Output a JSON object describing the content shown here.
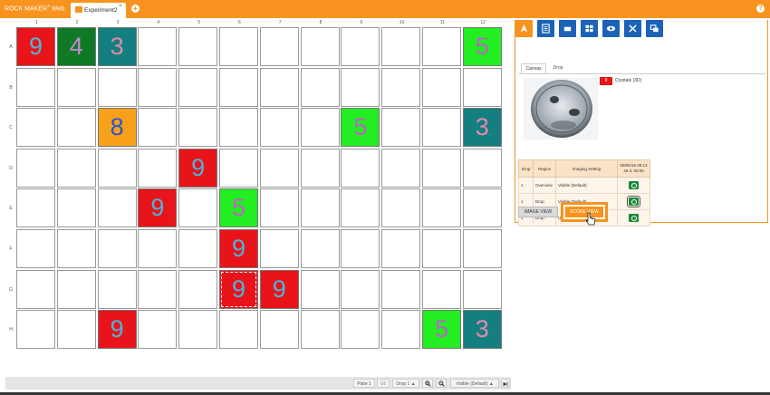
{
  "app": {
    "title": "ROCK MAKER",
    "title_sup": "®",
    "title_suffix": "Web",
    "tab_label": "Experiment2",
    "tab_close": "×",
    "new_tab": "+",
    "help": "?"
  },
  "plate": {
    "columns": [
      "1",
      "2",
      "3",
      "4",
      "5",
      "6",
      "7",
      "8",
      "9",
      "10",
      "11",
      "12"
    ],
    "rows": [
      "A",
      "B",
      "C",
      "D",
      "E",
      "F",
      "G",
      "H"
    ],
    "scored_wells": [
      {
        "row": "A",
        "col": 1,
        "score": "9",
        "bg": "#e8141a",
        "fg": "#4fb3d9"
      },
      {
        "row": "A",
        "col": 2,
        "score": "4",
        "bg": "#0f7a25",
        "fg": "#c08ccf"
      },
      {
        "row": "A",
        "col": 3,
        "score": "3",
        "bg": "#137f80",
        "fg": "#e48aa8"
      },
      {
        "row": "A",
        "col": 12,
        "score": "5",
        "bg": "#22ee22",
        "fg": "#c060c8"
      },
      {
        "row": "C",
        "col": 3,
        "score": "8",
        "bg": "#f9a01b",
        "fg": "#2a57c8"
      },
      {
        "row": "C",
        "col": 9,
        "score": "5",
        "bg": "#22ee22",
        "fg": "#c060c8"
      },
      {
        "row": "C",
        "col": 12,
        "score": "3",
        "bg": "#137f80",
        "fg": "#e48aa8"
      },
      {
        "row": "D",
        "col": 5,
        "score": "9",
        "bg": "#e8141a",
        "fg": "#4fb3d9"
      },
      {
        "row": "E",
        "col": 4,
        "score": "9",
        "bg": "#e8141a",
        "fg": "#4fb3d9"
      },
      {
        "row": "E",
        "col": 6,
        "score": "5",
        "bg": "#22ee22",
        "fg": "#c060c8"
      },
      {
        "row": "F",
        "col": 6,
        "score": "9",
        "bg": "#e8141a",
        "fg": "#4fb3d9"
      },
      {
        "row": "G",
        "col": 6,
        "score": "9",
        "bg": "#e8141a",
        "fg": "#4fb3d9",
        "selected": true
      },
      {
        "row": "G",
        "col": 7,
        "score": "9",
        "bg": "#e8141a",
        "fg": "#4fb3d9"
      },
      {
        "row": "H",
        "col": 3,
        "score": "9",
        "bg": "#e8141a",
        "fg": "#4fb3d9"
      },
      {
        "row": "H",
        "col": 11,
        "score": "5",
        "bg": "#22ee22",
        "fg": "#c060c8"
      },
      {
        "row": "H",
        "col": 12,
        "score": "3",
        "bg": "#137f80",
        "fg": "#e48aa8"
      }
    ]
  },
  "bottom_bar": {
    "plate": "Plate 1",
    "well": "G6",
    "drop": "Drop 1",
    "drop_arrow": "▲",
    "imaging": "Visible (Default)",
    "imaging_arrow": "▲"
  },
  "right_panel": {
    "toolbar_icons": [
      "pointer-icon",
      "list-icon",
      "rectangle-icon",
      "grid-icon",
      "eye-icon",
      "crossed-tools-icon",
      "copy-windows-icon"
    ],
    "tabs": {
      "canvas": "Canvas",
      "drop": "Drop"
    },
    "score": {
      "value": "9",
      "label": "Crystals (3D)"
    },
    "table": {
      "headers": [
        "Drop",
        "Region",
        "Imaging Setting",
        "09/05/16 05:13\n46 d, 00:00"
      ],
      "rows": [
        {
          "drop": "1",
          "region": "Overview",
          "setting": "Visible (Default)",
          "boxed": false
        },
        {
          "drop": "1",
          "region": "Drop",
          "setting": "Visible (Default)",
          "boxed": true
        },
        {
          "drop": "1",
          "region": "Drop",
          "setting": "UV",
          "boxed": false
        }
      ]
    },
    "image_view_label": "IMAGE VIEW",
    "score_view_label": "SCORE VIEW"
  },
  "colors": {
    "accent": "#f7931e",
    "toolbar_blue": "#1c63b7"
  }
}
